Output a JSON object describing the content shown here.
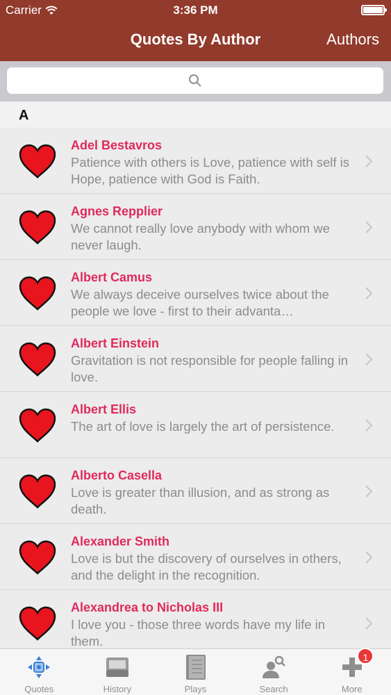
{
  "status": {
    "carrier": "Carrier",
    "time": "3:36 PM"
  },
  "nav": {
    "title": "Quotes By Author",
    "right_button": "Authors"
  },
  "search": {
    "placeholder": ""
  },
  "section": "A",
  "rows": [
    {
      "author": "Adel Bestavros",
      "quote": "Patience with others is Love, patience with self is Hope, patience with God is Faith."
    },
    {
      "author": "Agnes Repplier",
      "quote": "We cannot really love anybody with whom we never laugh."
    },
    {
      "author": "Albert Camus",
      "quote": "We always deceive ourselves twice about the people we love - first to their advanta…"
    },
    {
      "author": "Albert Einstein",
      "quote": "Gravitation is not responsible for people falling in love."
    },
    {
      "author": "Albert Ellis",
      "quote": "The art of love is largely the art of persistence."
    },
    {
      "author": "Alberto Casella",
      "quote": "Love is greater than illusion, and as strong as death."
    },
    {
      "author": "Alexander Smith",
      "quote": "Love is but the discovery of ourselves in others, and the delight in the recognition."
    },
    {
      "author": "Alexandrea to Nicholas III",
      "quote": "I love you - those three words have my life in them."
    }
  ],
  "tabs": [
    {
      "label": "Quotes",
      "icon": "quotes-icon"
    },
    {
      "label": "History",
      "icon": "inbox-tray-icon"
    },
    {
      "label": "Plays",
      "icon": "notebook-icon"
    },
    {
      "label": "Search",
      "icon": "person-search-icon"
    },
    {
      "label": "More",
      "icon": "plus-icon",
      "badge": "1"
    }
  ],
  "colors": {
    "nav_bar": "#923a2c",
    "author_text": "#df2a5c",
    "heart": "#e8141e",
    "badge": "#ea3737"
  }
}
